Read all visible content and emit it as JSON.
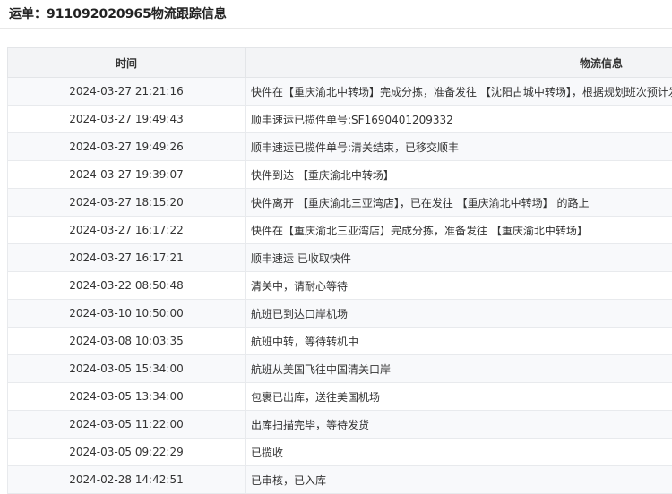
{
  "header": {
    "title": "运单：911092020965物流跟踪信息"
  },
  "table": {
    "columns": [
      "时间",
      "物流信息"
    ],
    "rows": [
      {
        "time": "2024-03-27 21:21:16",
        "info": "快件在【重庆渝北中转场】完成分拣，准备发往 【沈阳古城中转场】，根据规划班次预计发"
      },
      {
        "time": "2024-03-27 19:49:43",
        "info": "顺丰速运已揽件单号:SF1690401209332"
      },
      {
        "time": "2024-03-27 19:49:26",
        "info": "顺丰速运已揽件单号:清关结束，已移交顺丰"
      },
      {
        "time": "2024-03-27 19:39:07",
        "info": "快件到达 【重庆渝北中转场】"
      },
      {
        "time": "2024-03-27 18:15:20",
        "info": "快件离开 【重庆渝北三亚湾店】，已在发往 【重庆渝北中转场】 的路上"
      },
      {
        "time": "2024-03-27 16:17:22",
        "info": "快件在【重庆渝北三亚湾店】完成分拣，准备发往 【重庆渝北中转场】"
      },
      {
        "time": "2024-03-27 16:17:21",
        "info": "顺丰速运 已收取快件"
      },
      {
        "time": "2024-03-22 08:50:48",
        "info": "清关中，请耐心等待"
      },
      {
        "time": "2024-03-10 10:50:00",
        "info": "航班已到达口岸机场"
      },
      {
        "time": "2024-03-08 10:03:35",
        "info": "航班中转，等待转机中"
      },
      {
        "time": "2024-03-05 15:34:00",
        "info": "航班从美国飞往中国清关口岸"
      },
      {
        "time": "2024-03-05 13:34:00",
        "info": "包裹已出库，送往美国机场"
      },
      {
        "time": "2024-03-05 11:22:00",
        "info": "出库扫描完毕，等待发货"
      },
      {
        "time": "2024-03-05 09:22:29",
        "info": "已揽收"
      },
      {
        "time": "2024-02-28 14:42:51",
        "info": "已审核，已入库"
      }
    ]
  }
}
